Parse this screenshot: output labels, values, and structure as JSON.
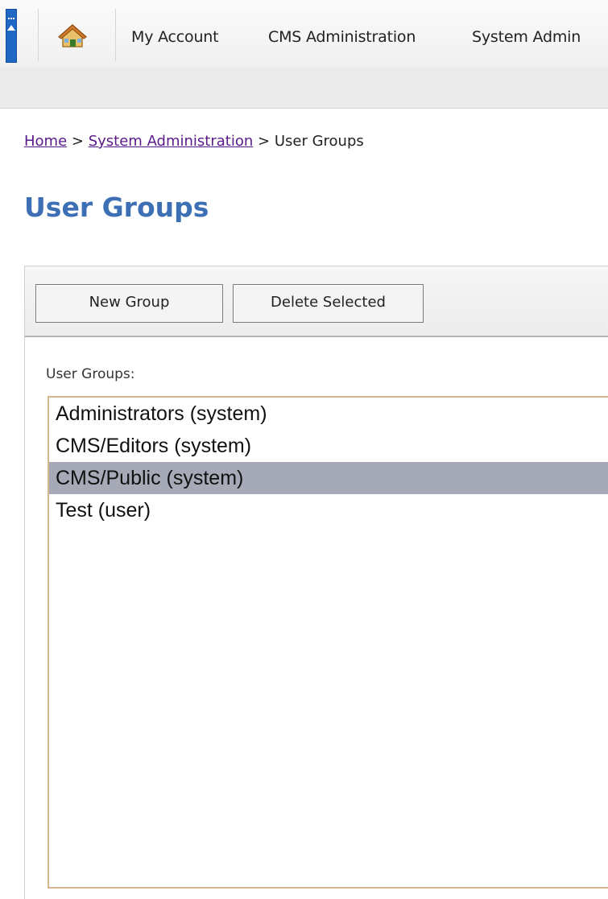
{
  "nav": {
    "items": [
      "My Account",
      "CMS Administration",
      "System Admin"
    ],
    "home_icon": "home-icon",
    "collapse_icon": "collapse-arrow-icon"
  },
  "breadcrumb": {
    "home": "Home",
    "sep1": ">",
    "system_admin": "System Administration",
    "sep2": ">",
    "current": "User Groups"
  },
  "page": {
    "title": "User Groups"
  },
  "toolbar": {
    "new_group_label": "New Group",
    "delete_selected_label": "Delete Selected"
  },
  "groups": {
    "label": "User Groups:",
    "items": [
      "Administrators (system)",
      "CMS/Editors (system)",
      "CMS/Public (system)",
      "Test (user)"
    ],
    "selected_index": 2
  },
  "colors": {
    "accent": "#3d6fb4",
    "nav_collapse": "#1f69c4",
    "selection": "#a6a9b6",
    "listbox_border": "#d3b68c",
    "link_visited": "#5a1a8a"
  }
}
